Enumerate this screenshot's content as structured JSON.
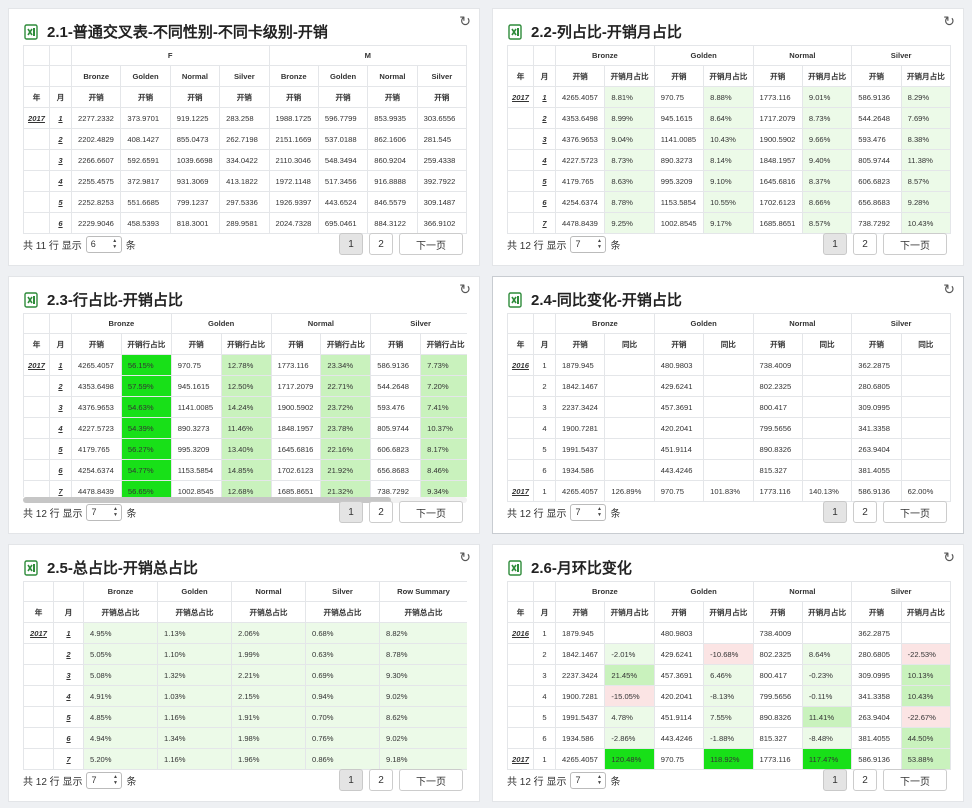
{
  "colors": {
    "green_light": "#ecfae8",
    "green_mid": "#c9f2bd",
    "green_strong": "#18e018",
    "red_light": "#fbe4e4"
  },
  "icons": {
    "title": "excel-file-icon",
    "refresh": "refresh-icon"
  },
  "p1": {
    "title": "2.1-普通交叉表-不同性别-不同卡级别-开销",
    "head1": [
      "F",
      "M"
    ],
    "head2": [
      "Bronze",
      "Golden",
      "Normal",
      "Silver",
      "Bronze",
      "Golden",
      "Normal",
      "Silver"
    ],
    "head3": [
      "年",
      "月",
      "开销",
      "开销",
      "开销",
      "开销",
      "开销",
      "开销",
      "开销",
      "开销"
    ],
    "rows": [
      {
        "y": "2017",
        "m": "1",
        "v": [
          "2277.2332",
          "373.9701",
          "919.1225",
          "283.258",
          "1988.1725",
          "596.7799",
          "853.9935",
          "303.6556"
        ]
      },
      {
        "y": "",
        "m": "2",
        "v": [
          "2202.4829",
          "408.1427",
          "855.0473",
          "262.7198",
          "2151.1669",
          "537.0188",
          "862.1606",
          "281.545"
        ]
      },
      {
        "y": "",
        "m": "3",
        "v": [
          "2266.6607",
          "592.6591",
          "1039.6698",
          "334.0422",
          "2110.3046",
          "548.3494",
          "860.9204",
          "259.4338"
        ]
      },
      {
        "y": "",
        "m": "4",
        "v": [
          "2255.4575",
          "372.9817",
          "931.3069",
          "413.1822",
          "1972.1148",
          "517.3456",
          "916.8888",
          "392.7922"
        ]
      },
      {
        "y": "",
        "m": "5",
        "v": [
          "2252.8253",
          "551.6685",
          "799.1237",
          "297.5336",
          "1926.9397",
          "443.6524",
          "846.5579",
          "309.1487"
        ]
      },
      {
        "y": "",
        "m": "6",
        "v": [
          "2229.9046",
          "458.5393",
          "818.3001",
          "289.9581",
          "2024.7328",
          "695.0461",
          "884.3122",
          "366.9102"
        ]
      }
    ],
    "footer": {
      "prefix": "共 11 行 显示",
      "size": "6",
      "suffix": "条",
      "p1": "1",
      "p2": "2",
      "next": "下一页"
    }
  },
  "p2": {
    "title": "2.2-列占比-开销月占比",
    "head1": [
      "Bronze",
      "Golden",
      "Normal",
      "Silver"
    ],
    "head2": [
      "年",
      "月",
      "开销",
      "开销月占比",
      "开销",
      "开销月占比",
      "开销",
      "开销月占比",
      "开销",
      "开销月占比"
    ],
    "rows": [
      {
        "y": "2017",
        "m": "1",
        "v": [
          "4265.4057",
          "8.81%",
          "970.75",
          "8.88%",
          "1773.116",
          "9.01%",
          "586.9136",
          "8.29%"
        ]
      },
      {
        "y": "",
        "m": "2",
        "v": [
          "4353.6498",
          "8.99%",
          "945.1615",
          "8.64%",
          "1717.2079",
          "8.73%",
          "544.2648",
          "7.69%"
        ]
      },
      {
        "y": "",
        "m": "3",
        "v": [
          "4376.9653",
          "9.04%",
          "1141.0085",
          "10.43%",
          "1900.5902",
          "9.66%",
          "593.476",
          "8.38%"
        ]
      },
      {
        "y": "",
        "m": "4",
        "v": [
          "4227.5723",
          "8.73%",
          "890.3273",
          "8.14%",
          "1848.1957",
          "9.40%",
          "805.9744",
          "11.38%"
        ]
      },
      {
        "y": "",
        "m": "5",
        "v": [
          "4179.765",
          "8.63%",
          "995.3209",
          "9.10%",
          "1645.6816",
          "8.37%",
          "606.6823",
          "8.57%"
        ]
      },
      {
        "y": "",
        "m": "6",
        "v": [
          "4254.6374",
          "8.78%",
          "1153.5854",
          "10.55%",
          "1702.6123",
          "8.66%",
          "656.8683",
          "9.28%"
        ]
      },
      {
        "y": "",
        "m": "7",
        "v": [
          "4478.8439",
          "9.25%",
          "1002.8545",
          "9.17%",
          "1685.8651",
          "8.57%",
          "738.7292",
          "10.43%"
        ]
      }
    ],
    "footer": {
      "prefix": "共 12 行 显示",
      "size": "7",
      "suffix": "条",
      "p1": "1",
      "p2": "2",
      "next": "下一页"
    }
  },
  "p3": {
    "title": "2.3-行占比-开销占比",
    "head1": [
      "Bronze",
      "Golden",
      "Normal",
      "Silver",
      "R"
    ],
    "head2": [
      "年",
      "月",
      "开销",
      "开销行占比",
      "开销",
      "开销行占比",
      "开销",
      "开销行占比",
      "开销",
      "开销行占比"
    ],
    "rows": [
      {
        "y": "2017",
        "m": "1",
        "v": [
          "4265.4057",
          "56.15%",
          "970.75",
          "12.78%",
          "1773.116",
          "23.34%",
          "586.9136",
          "7.73%"
        ]
      },
      {
        "y": "",
        "m": "2",
        "v": [
          "4353.6498",
          "57.59%",
          "945.1615",
          "12.50%",
          "1717.2079",
          "22.71%",
          "544.2648",
          "7.20%"
        ]
      },
      {
        "y": "",
        "m": "3",
        "v": [
          "4376.9653",
          "54.63%",
          "1141.0085",
          "14.24%",
          "1900.5902",
          "23.72%",
          "593.476",
          "7.41%"
        ]
      },
      {
        "y": "",
        "m": "4",
        "v": [
          "4227.5723",
          "54.39%",
          "890.3273",
          "11.46%",
          "1848.1957",
          "23.78%",
          "805.9744",
          "10.37%"
        ]
      },
      {
        "y": "",
        "m": "5",
        "v": [
          "4179.765",
          "56.27%",
          "995.3209",
          "13.40%",
          "1645.6816",
          "22.16%",
          "606.6823",
          "8.17%"
        ]
      },
      {
        "y": "",
        "m": "6",
        "v": [
          "4254.6374",
          "54.77%",
          "1153.5854",
          "14.85%",
          "1702.6123",
          "21.92%",
          "656.8683",
          "8.46%"
        ]
      },
      {
        "y": "",
        "m": "7",
        "v": [
          "4478.8439",
          "56.65%",
          "1002.8545",
          "12.68%",
          "1685.8651",
          "21.32%",
          "738.7292",
          "9.34%"
        ]
      }
    ],
    "footer": {
      "prefix": "共 12 行 显示",
      "size": "7",
      "suffix": "条",
      "p1": "1",
      "p2": "2",
      "next": "下一页"
    }
  },
  "p4": {
    "title": "2.4-同比变化-开销占比",
    "head1": [
      "Bronze",
      "Golden",
      "Normal",
      "Silver"
    ],
    "head2": [
      "年",
      "月",
      "开销",
      "同比",
      "开销",
      "同比",
      "开销",
      "同比",
      "开销",
      "同比"
    ],
    "rows": [
      {
        "y": "2016",
        "m": "1",
        "v": [
          "1879.945",
          "",
          "480.9803",
          "",
          "738.4009",
          "",
          "362.2875",
          ""
        ]
      },
      {
        "y": "",
        "m": "2",
        "v": [
          "1842.1467",
          "",
          "429.6241",
          "",
          "802.2325",
          "",
          "280.6805",
          ""
        ]
      },
      {
        "y": "",
        "m": "3",
        "v": [
          "2237.3424",
          "",
          "457.3691",
          "",
          "800.417",
          "",
          "309.0995",
          ""
        ]
      },
      {
        "y": "",
        "m": "4",
        "v": [
          "1900.7281",
          "",
          "420.2041",
          "",
          "799.5656",
          "",
          "341.3358",
          ""
        ]
      },
      {
        "y": "",
        "m": "5",
        "v": [
          "1991.5437",
          "",
          "451.9114",
          "",
          "890.8326",
          "",
          "263.9404",
          ""
        ]
      },
      {
        "y": "",
        "m": "6",
        "v": [
          "1934.586",
          "",
          "443.4246",
          "",
          "815.327",
          "",
          "381.4055",
          ""
        ]
      },
      {
        "y": "2017",
        "m": "1",
        "v": [
          "4265.4057",
          "126.89%",
          "970.75",
          "101.83%",
          "1773.116",
          "140.13%",
          "586.9136",
          "62.00%"
        ]
      }
    ],
    "footer": {
      "prefix": "共 12 行 显示",
      "size": "7",
      "suffix": "条",
      "p1": "1",
      "p2": "2",
      "next": "下一页"
    }
  },
  "p5": {
    "title": "2.5-总占比-开销总占比",
    "head1": [
      "Bronze",
      "Golden",
      "Normal",
      "Silver",
      "Row Summary"
    ],
    "head2": [
      "年",
      "月",
      "开销总占比",
      "开销总占比",
      "开销总占比",
      "开销总占比",
      "开销总占比"
    ],
    "rows": [
      {
        "y": "2017",
        "m": "1",
        "v": [
          "4.95%",
          "1.13%",
          "2.06%",
          "0.68%",
          "8.82%"
        ]
      },
      {
        "y": "",
        "m": "2",
        "v": [
          "5.05%",
          "1.10%",
          "1.99%",
          "0.63%",
          "8.78%"
        ]
      },
      {
        "y": "",
        "m": "3",
        "v": [
          "5.08%",
          "1.32%",
          "2.21%",
          "0.69%",
          "9.30%"
        ]
      },
      {
        "y": "",
        "m": "4",
        "v": [
          "4.91%",
          "1.03%",
          "2.15%",
          "0.94%",
          "9.02%"
        ]
      },
      {
        "y": "",
        "m": "5",
        "v": [
          "4.85%",
          "1.16%",
          "1.91%",
          "0.70%",
          "8.62%"
        ]
      },
      {
        "y": "",
        "m": "6",
        "v": [
          "4.94%",
          "1.34%",
          "1.98%",
          "0.76%",
          "9.02%"
        ]
      },
      {
        "y": "",
        "m": "7",
        "v": [
          "5.20%",
          "1.16%",
          "1.96%",
          "0.86%",
          "9.18%"
        ]
      }
    ],
    "footer": {
      "prefix": "共 12 行 显示",
      "size": "7",
      "suffix": "条",
      "p1": "1",
      "p2": "2",
      "next": "下一页"
    }
  },
  "p6": {
    "title": "2.6-月环比变化",
    "head1": [
      "Bronze",
      "Golden",
      "Normal",
      "Silver"
    ],
    "head2": [
      "年",
      "月",
      "开销",
      "开销月占比",
      "开销",
      "开销月占比",
      "开销",
      "开销月占比",
      "开销",
      "开销月占比"
    ],
    "rows": [
      {
        "y": "2016",
        "m": "1",
        "v": [
          "1879.945",
          "",
          "480.9803",
          "",
          "738.4009",
          "",
          "362.2875",
          ""
        ]
      },
      {
        "y": "",
        "m": "2",
        "v": [
          "1842.1467",
          "-2.01%",
          "429.6241",
          "-10.68%",
          "802.2325",
          "8.64%",
          "280.6805",
          "-22.53%"
        ]
      },
      {
        "y": "",
        "m": "3",
        "v": [
          "2237.3424",
          "21.45%",
          "457.3691",
          "6.46%",
          "800.417",
          "-0.23%",
          "309.0995",
          "10.13%"
        ]
      },
      {
        "y": "",
        "m": "4",
        "v": [
          "1900.7281",
          "-15.05%",
          "420.2041",
          "-8.13%",
          "799.5656",
          "-0.11%",
          "341.3358",
          "10.43%"
        ]
      },
      {
        "y": "",
        "m": "5",
        "v": [
          "1991.5437",
          "4.78%",
          "451.9114",
          "7.55%",
          "890.8326",
          "11.41%",
          "263.9404",
          "-22.67%"
        ]
      },
      {
        "y": "",
        "m": "6",
        "v": [
          "1934.586",
          "-2.86%",
          "443.4246",
          "-1.88%",
          "815.327",
          "-8.48%",
          "381.4055",
          "44.50%"
        ]
      },
      {
        "y": "2017",
        "m": "1",
        "v": [
          "4265.4057",
          "120.48%",
          "970.75",
          "118.92%",
          "1773.116",
          "117.47%",
          "586.9136",
          "53.88%"
        ]
      }
    ],
    "footer": {
      "prefix": "共 12 行 显示",
      "size": "7",
      "suffix": "条",
      "p1": "1",
      "p2": "2",
      "next": "下一页"
    }
  }
}
